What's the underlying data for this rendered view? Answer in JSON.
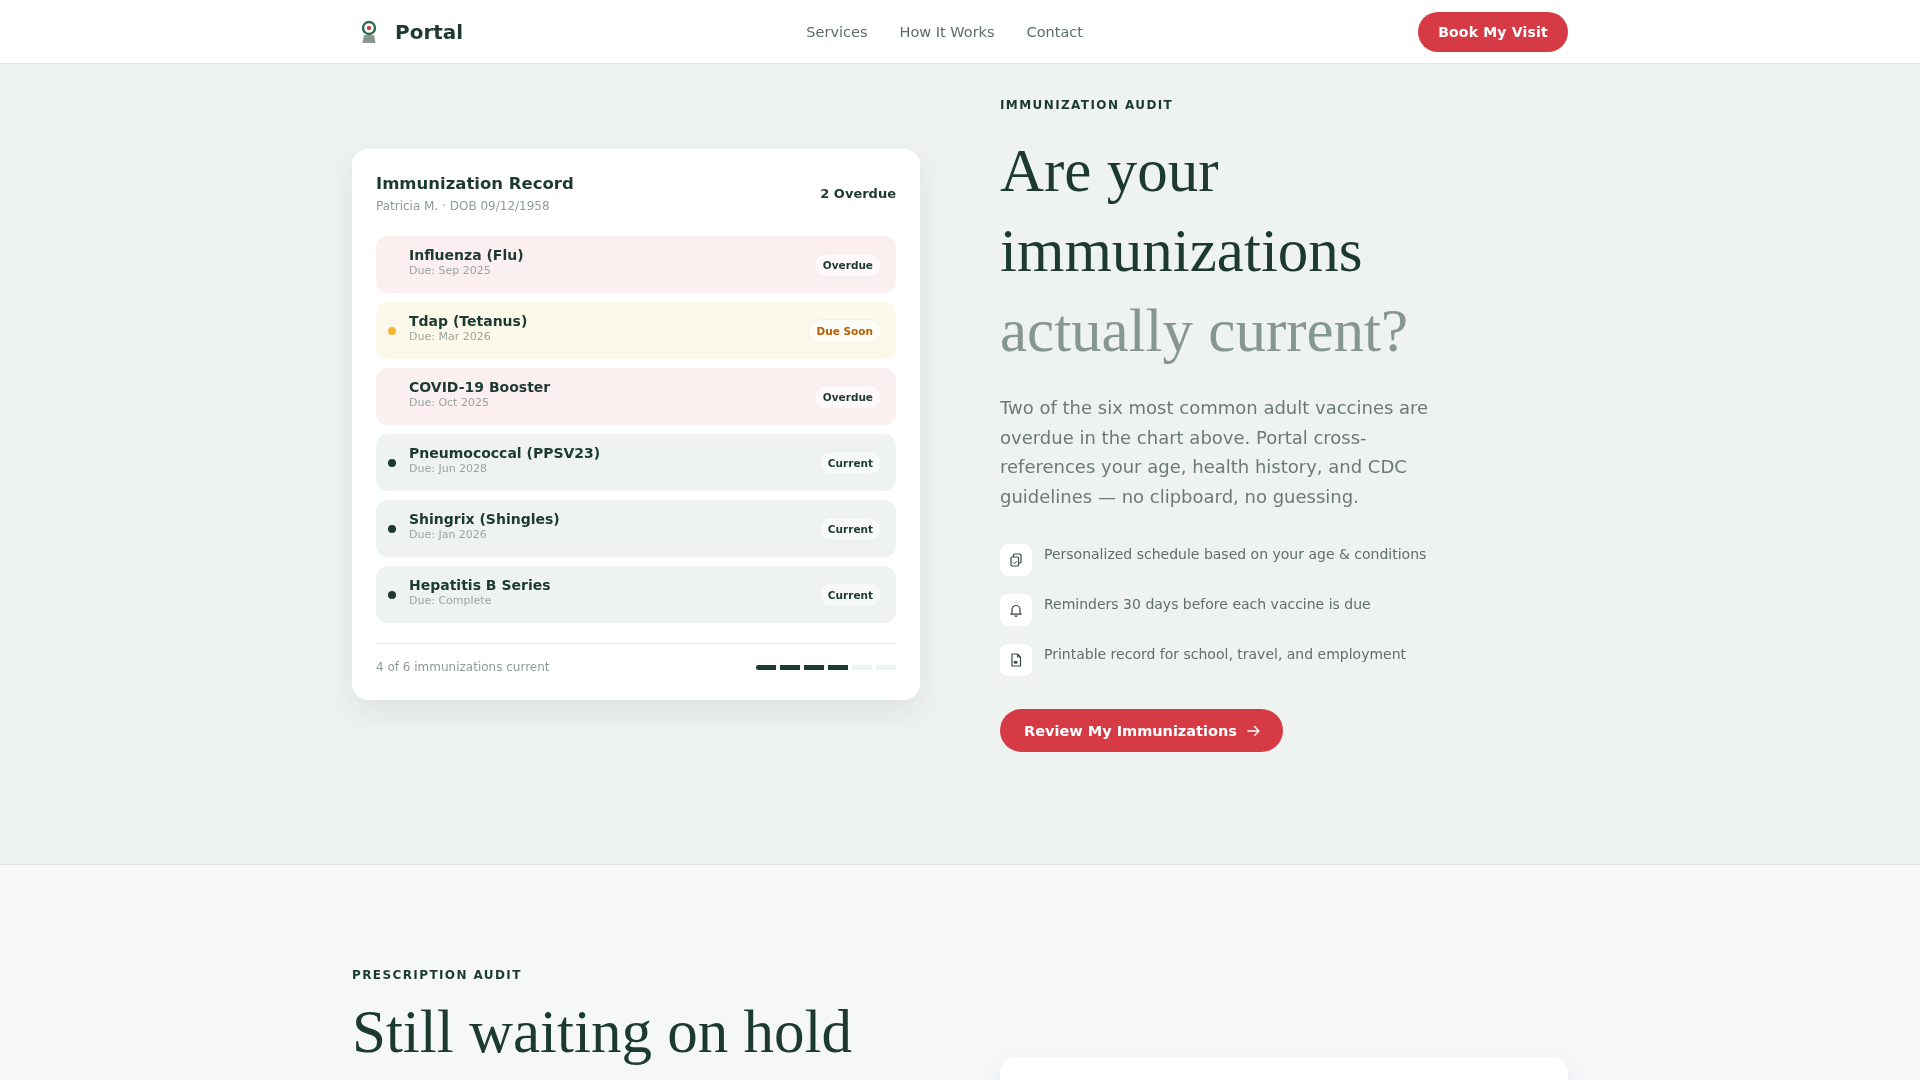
{
  "header": {
    "logo": "Portal",
    "nav": [
      "Services",
      "How It Works",
      "Contact"
    ],
    "cta": "Book My Visit"
  },
  "hero": {
    "record_card": {
      "title": "Immunization Record",
      "subtitle": "Patricia M. · DOB 09/12/1958",
      "overdue_count": "2 Overdue",
      "rows": [
        {
          "name": "Influenza (Flu)",
          "due": "Due: Sep 2025",
          "kind": "overdue",
          "badge": "Overdue"
        },
        {
          "name": "Tdap (Tetanus)",
          "due": "Due: Mar 2026",
          "kind": "upcoming",
          "badge": "Due Soon",
          "color": "#f5b731"
        },
        {
          "name": "COVID-19 Booster",
          "due": "Due: Oct 2025",
          "kind": "overdue",
          "badge": "Overdue"
        },
        {
          "name": "Pneumococcal (PPSV23)",
          "due": "Due: Jun 2028",
          "kind": "current",
          "badge": "Current",
          "color": "#1c3a2f"
        },
        {
          "name": "Shingrix (Shingles)",
          "due": "Due: Jan 2026",
          "kind": "current",
          "badge": "Current",
          "color": "#1c3a2f"
        },
        {
          "name": "Hepatitis B Series",
          "due": "Due: Complete",
          "kind": "current",
          "badge": "Current",
          "color": "#1c3a2f"
        }
      ],
      "footer": {
        "summary": "4 of 6 immunizations current",
        "level": 0.667
      }
    },
    "eyebrow": "IMMUNIZATION AUDIT",
    "headline": "Are your immunizations",
    "headline_accent": "actually current?",
    "body": "Two of the six most common adult vaccines are overdue in the chart above. Portal cross-references your age, health history, and CDC guidelines — no clipboard, no guessing.",
    "features": [
      "Personalized schedule based on your age & conditions",
      "Reminders 30 days before each vaccine is due",
      "Printable record for school, travel, and employment"
    ],
    "button": "Review My Immunizations"
  },
  "next_section": {
    "eyebrow": "PRESCRIPTION AUDIT",
    "headline": "Still waiting on hold"
  }
}
